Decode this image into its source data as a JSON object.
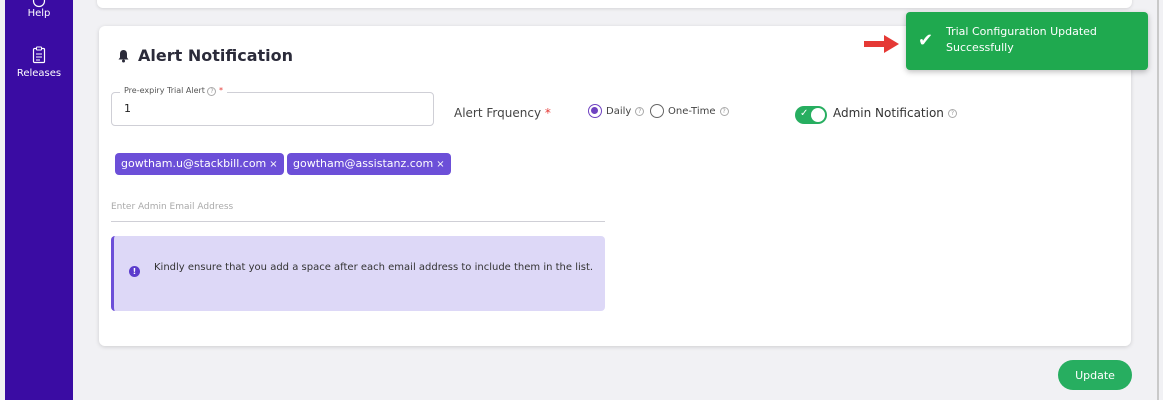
{
  "sidebar": {
    "items": [
      {
        "label": "Help",
        "icon": "help-icon"
      },
      {
        "label": "Releases",
        "icon": "clipboard-icon"
      }
    ]
  },
  "section": {
    "title": "Alert Notification",
    "icon": "bell-icon"
  },
  "trial_alert": {
    "label": "Pre-expiry Trial Alert",
    "required_mark": "*",
    "value": "1"
  },
  "frequency": {
    "label": "Alert Frquency",
    "required_mark": "*",
    "options": [
      {
        "label": "Daily",
        "selected": true
      },
      {
        "label": "One-Time",
        "selected": false
      }
    ]
  },
  "admin_notification": {
    "label": "Admin Notification",
    "enabled": true
  },
  "emails": [
    {
      "address": "gowtham.u@stackbill.com",
      "remove": "×"
    },
    {
      "address": "gowtham@assistanz.com",
      "remove": "×"
    }
  ],
  "email_input": {
    "placeholder": "Enter Admin Email Address"
  },
  "notice": {
    "text": "Kindly ensure that you add a space after each email address to include them in the list.",
    "icon_glyph": "!"
  },
  "toast": {
    "message": "Trial Configuration Updated Successfully"
  },
  "buttons": {
    "update": "Update"
  },
  "colors": {
    "sidebar": "#3a0ca3",
    "accent": "#6c4fd8",
    "success": "#1fa94f",
    "arrow": "#e53935"
  }
}
